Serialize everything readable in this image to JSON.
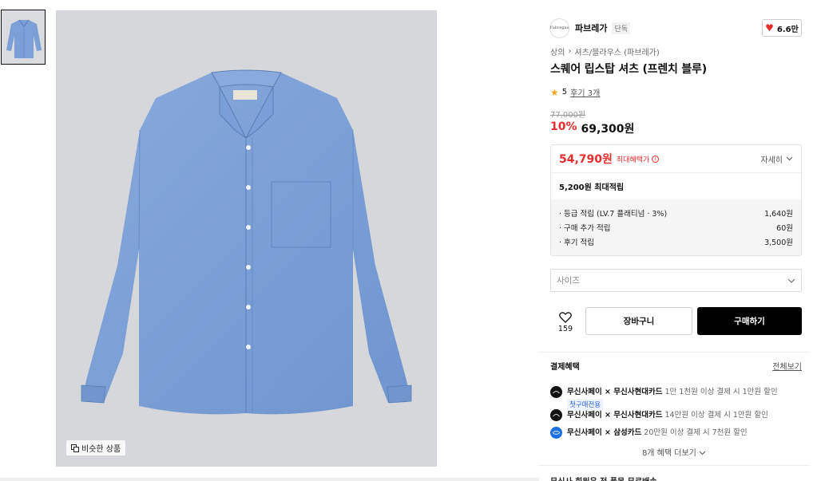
{
  "gallery": {
    "similar_label": "비슷한 상품",
    "thumbnail_count": 1
  },
  "brand": {
    "name": "파브레가",
    "logo_text": "Fabregas",
    "tag": "단독",
    "like_count": "6.6만"
  },
  "breadcrumb": [
    "상의",
    "셔츠/블라우스 (파브레가)"
  ],
  "product": {
    "title": "스퀘어 립스탑 셔츠 (프렌치 블루)",
    "rating": "5",
    "reviews": "후기 3개",
    "original_price": "77,000원",
    "discount_rate": "10%",
    "price": "69,300원"
  },
  "benefit": {
    "max_price": "54,790원",
    "max_label": "최대혜택가",
    "info_icon": "i",
    "detail_label": "자세히",
    "points_total": "5,200원 최대적립",
    "lines": [
      {
        "label": "· 등급 적립 (LV.7 플래티넘 · 3%)",
        "value": "1,640원"
      },
      {
        "label": "· 구매 추가 적립",
        "value": "60원"
      },
      {
        "label": "· 후기 적립",
        "value": "3,500원"
      }
    ]
  },
  "size_select": {
    "placeholder": "사이즈"
  },
  "actions": {
    "wish_count": "159",
    "cart_label": "장바구니",
    "buy_label": "구매하기"
  },
  "payment": {
    "heading": "결제혜택",
    "more_label": "전체보기",
    "items": [
      {
        "bold": "무신사페이 × 무신사현대카드",
        "text": " 1만 1천원 이상 결제 시 1만원 할인",
        "tag": "첫구매전용"
      },
      {
        "bold": "무신사페이 × 무신사현대카드",
        "text": " 14만원 이상 결제 시 1만원 할인",
        "tag": ""
      },
      {
        "bold": "무신사페이 × 삼성카드",
        "text": " 20만원 이상 결제 시 7천원 할인",
        "tag": ""
      }
    ],
    "more_benefits": "8개 혜택 더보기",
    "bottom_text": "무신사 회원은 전 품목 무료배송"
  },
  "colors": {
    "accent_red": "#e62e2e",
    "shirt_blue": "#7b9fd6",
    "background_gray": "#d5d7da",
    "buy_black": "#000000"
  }
}
